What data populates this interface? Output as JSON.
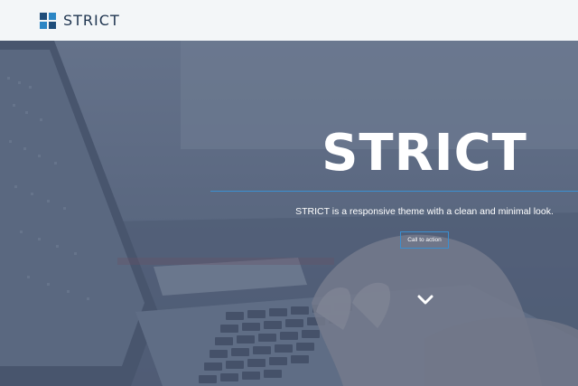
{
  "header": {
    "brand_name": "STRICT",
    "logo_icon": "four-squares-logo-icon"
  },
  "hero": {
    "title": "STRICT",
    "tagline": "STRICT is a responsive theme with a clean and minimal look.",
    "cta_label": "Call to action",
    "scroll_icon": "chevron-down-icon"
  },
  "colors": {
    "header_bg": "#f3f6f8",
    "brand_text": "#1f3550",
    "accent": "#3b8fd1",
    "logo_dark": "#1e4d7a",
    "logo_light": "#2b86c5",
    "hero_text": "#ffffff"
  }
}
